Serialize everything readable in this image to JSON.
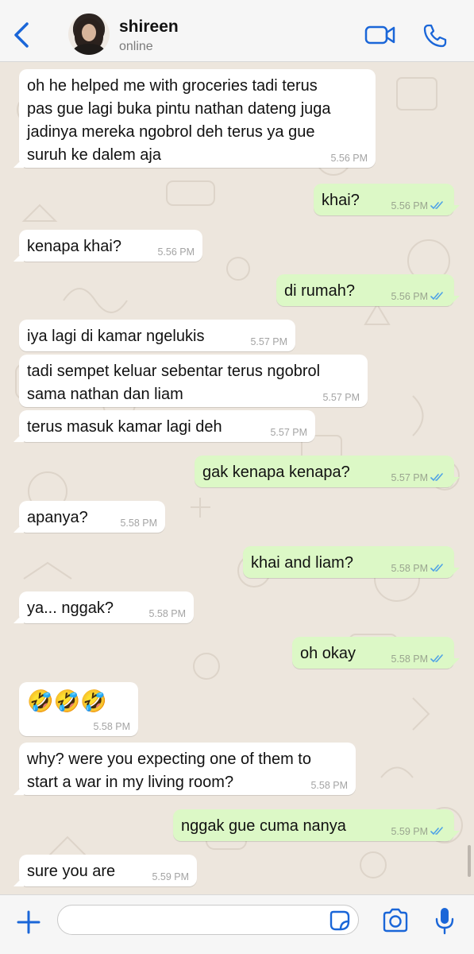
{
  "header": {
    "contact_name": "shireen",
    "status": "online"
  },
  "messages": [
    {
      "dir": "in",
      "text": "oh he helped me with groceries tadi terus\npas gue lagi buka pintu nathan dateng juga\njadinya mereka ngobrol deh terus ya gue\nsuruh ke dalem aja",
      "time": "5.56 PM"
    },
    {
      "dir": "out",
      "text": "khai?",
      "time": "5.56 PM"
    },
    {
      "dir": "in",
      "text": "kenapa khai?",
      "time": "5.56 PM"
    },
    {
      "dir": "out",
      "text": "di rumah?",
      "time": "5.56 PM"
    },
    {
      "dir": "in",
      "text": "iya lagi di kamar ngelukis",
      "time": "5.57 PM"
    },
    {
      "dir": "in",
      "text": "tadi sempet keluar sebentar terus ngobrol\nsama nathan dan liam",
      "time": "5.57 PM"
    },
    {
      "dir": "in",
      "text": "terus masuk kamar lagi deh",
      "time": "5.57 PM"
    },
    {
      "dir": "out",
      "text": "gak kenapa kenapa?",
      "time": "5.57 PM"
    },
    {
      "dir": "in",
      "text": "apanya?",
      "time": "5.58 PM"
    },
    {
      "dir": "out",
      "text": "khai and liam?",
      "time": "5.58 PM"
    },
    {
      "dir": "in",
      "text": "ya... nggak?",
      "time": "5.58 PM"
    },
    {
      "dir": "out",
      "text": "oh okay",
      "time": "5.58 PM"
    },
    {
      "dir": "in",
      "text": "🤣🤣🤣",
      "time": "5.58 PM"
    },
    {
      "dir": "in",
      "text": "why? were you expecting one of them to\nstart a war in my living room?",
      "time": "5.58 PM"
    },
    {
      "dir": "out",
      "text": "nggak gue cuma nanya",
      "time": "5.59 PM"
    },
    {
      "dir": "in",
      "text": "sure you are",
      "time": "5.59 PM"
    }
  ],
  "composer": {
    "value": "",
    "placeholder": ""
  },
  "icons": {
    "back": "chevron-left-icon",
    "video": "video-camera-icon",
    "call": "phone-icon",
    "plus": "plus-icon",
    "sticker": "sticker-icon",
    "camera": "camera-icon",
    "mic": "microphone-icon",
    "read_receipt": "double-check-icon"
  },
  "colors": {
    "accent": "#1a66d8",
    "incoming_bubble": "#ffffff",
    "outgoing_bubble": "#dcf8c6",
    "chat_background": "#ede6dd",
    "read_ticks": "#4fa2e6"
  }
}
